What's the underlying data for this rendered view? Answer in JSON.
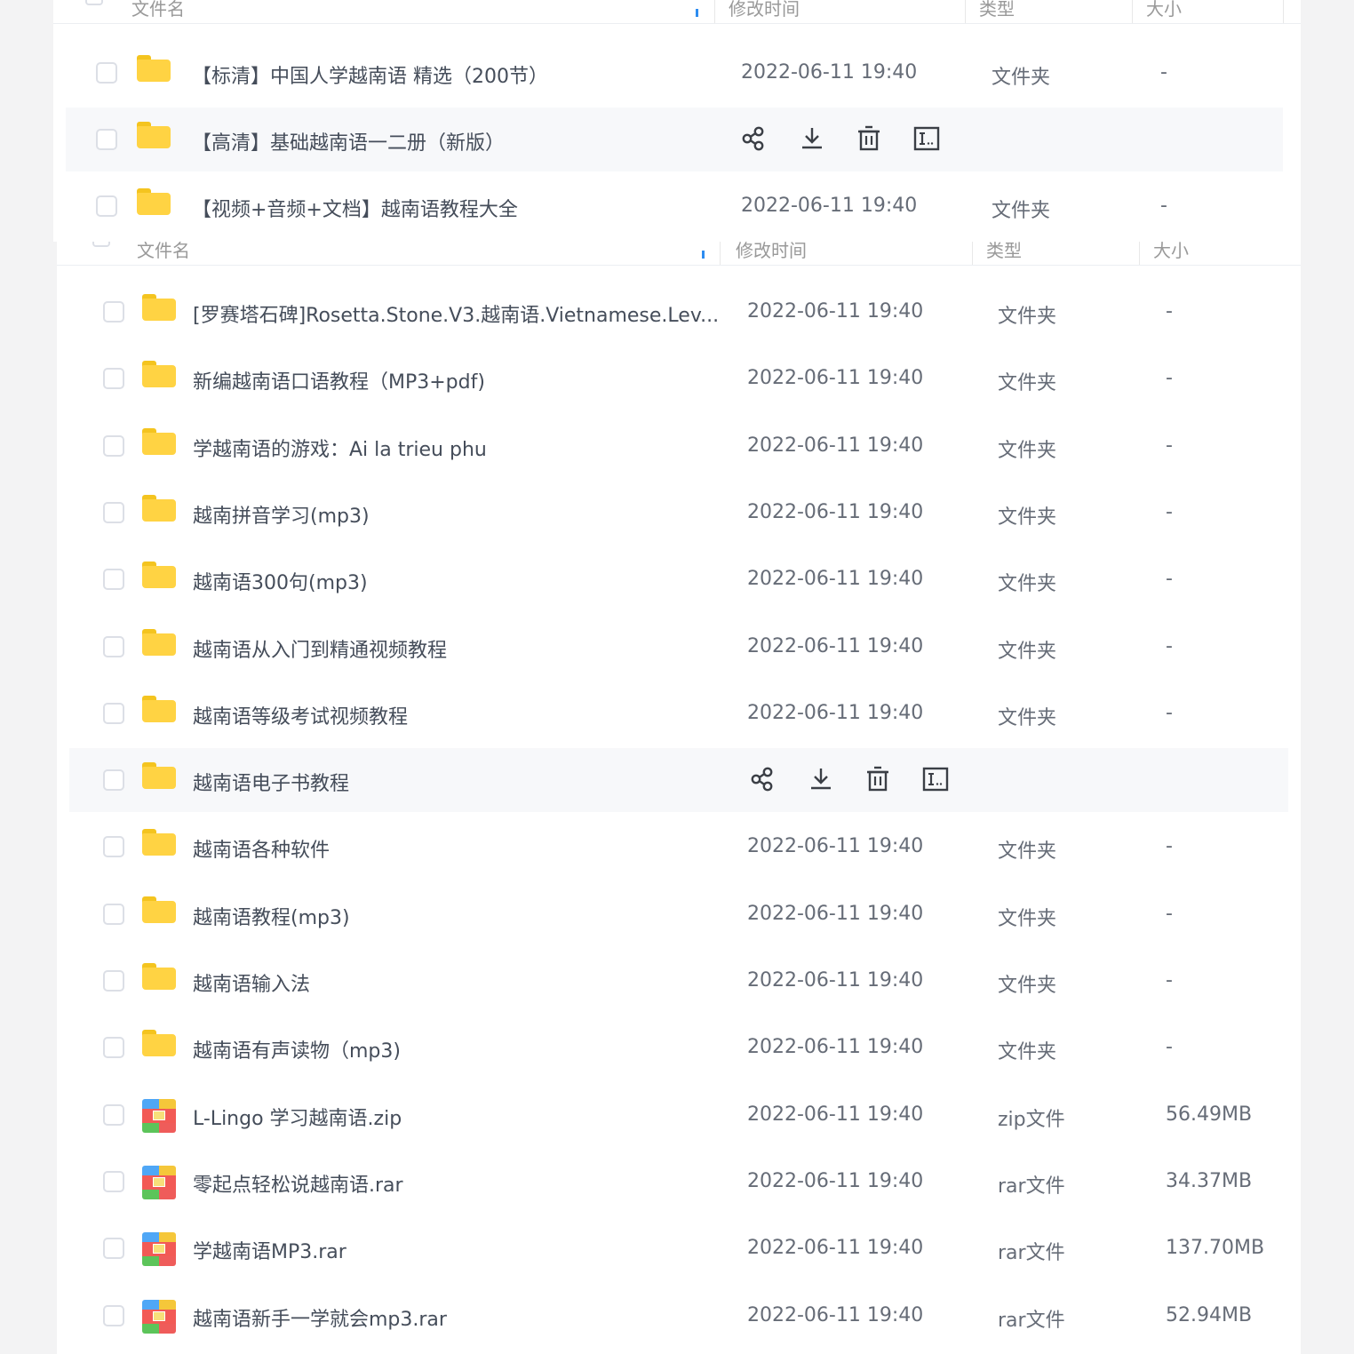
{
  "columns": {
    "name": "文件名",
    "modified": "修改时间",
    "type": "类型",
    "size": "大小"
  },
  "panel1": {
    "rows": [
      {
        "name": "【标清】中国人学越南语 精选（200节）",
        "time": "2022-06-11 19:40",
        "type": "文件夹",
        "size": "-"
      },
      {
        "name": "【高清】基础越南语一二册（新版）",
        "time": "",
        "type": "",
        "size": ""
      },
      {
        "name": "【视频+音频+文档】越南语教程大全",
        "time": "2022-06-11 19:40",
        "type": "文件夹",
        "size": "-"
      }
    ]
  },
  "panel2": {
    "rows": [
      {
        "name": "[罗赛塔石碑]Rosetta.Stone.V3.越南语.Vietnamese.Lev...",
        "time": "2022-06-11 19:40",
        "type": "文件夹",
        "size": "-"
      },
      {
        "name": "新编越南语口语教程（MP3+pdf)",
        "time": "2022-06-11 19:40",
        "type": "文件夹",
        "size": "-"
      },
      {
        "name": "学越南语的游戏：Ai la trieu phu",
        "time": "2022-06-11 19:40",
        "type": "文件夹",
        "size": "-"
      },
      {
        "name": "越南拼音学习(mp3)",
        "time": "2022-06-11 19:40",
        "type": "文件夹",
        "size": "-"
      },
      {
        "name": "越南语300句(mp3)",
        "time": "2022-06-11 19:40",
        "type": "文件夹",
        "size": "-"
      },
      {
        "name": "越南语从入门到精通视频教程",
        "time": "2022-06-11 19:40",
        "type": "文件夹",
        "size": "-"
      },
      {
        "name": "越南语等级考试视频教程",
        "time": "2022-06-11 19:40",
        "type": "文件夹",
        "size": "-"
      },
      {
        "name": "越南语电子书教程",
        "time": "",
        "type": "",
        "size": ""
      },
      {
        "name": "越南语各种软件",
        "time": "2022-06-11 19:40",
        "type": "文件夹",
        "size": "-"
      },
      {
        "name": "越南语教程(mp3)",
        "time": "2022-06-11 19:40",
        "type": "文件夹",
        "size": "-"
      },
      {
        "name": "越南语输入法",
        "time": "2022-06-11 19:40",
        "type": "文件夹",
        "size": "-"
      },
      {
        "name": "越南语有声读物（mp3)",
        "time": "2022-06-11 19:40",
        "type": "文件夹",
        "size": "-"
      },
      {
        "name": "L-Lingo 学习越南语.zip",
        "time": "2022-06-11 19:40",
        "type": "zip文件",
        "size": "56.49MB"
      },
      {
        "name": "零起点轻松说越南语.rar",
        "time": "2022-06-11 19:40",
        "type": "rar文件",
        "size": "34.37MB"
      },
      {
        "name": "学越南语MP3.rar",
        "time": "2022-06-11 19:40",
        "type": "rar文件",
        "size": "137.70MB"
      },
      {
        "name": "越南语新手一学就会mp3.rar",
        "time": "2022-06-11 19:40",
        "type": "rar文件",
        "size": "52.94MB"
      }
    ]
  },
  "row_icons": {
    "folder": "folder-icon",
    "archive": "archive-icon",
    "actions": [
      "share-icon",
      "download-icon",
      "delete-icon",
      "rename-icon"
    ]
  },
  "colors": {
    "folder": "#ffd343",
    "accent": "#2d8cf0",
    "hover_row": "#f7f8fa"
  }
}
